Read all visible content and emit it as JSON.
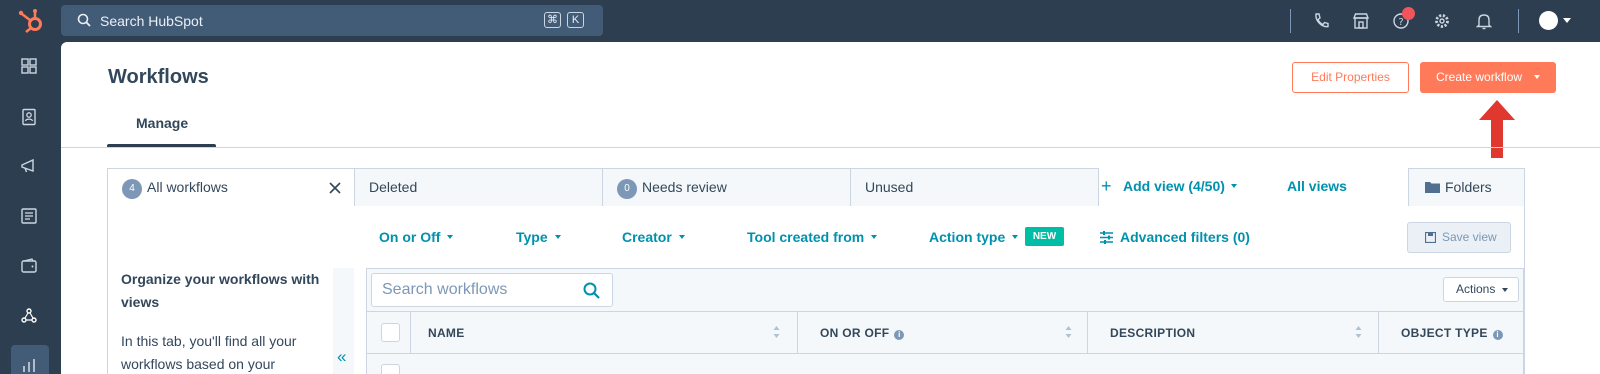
{
  "topbar": {
    "search_placeholder": "Search HubSpot",
    "shortcut_keys": [
      "⌘",
      "K"
    ],
    "icons": [
      "phone-icon",
      "marketplace-icon",
      "help-icon",
      "settings-icon",
      "notifications-icon",
      "avatar"
    ]
  },
  "leftnav": {
    "items": [
      "bookmarks-icon",
      "contacts-icon",
      "marketing-icon",
      "content-icon",
      "commerce-icon",
      "automation-icon",
      "reporting-icon"
    ],
    "active_index": 5
  },
  "header": {
    "title": "Workflows",
    "edit_properties_label": "Edit Properties",
    "create_workflow_label": "Create workflow",
    "tabs": [
      {
        "label": "Manage",
        "active": true
      }
    ]
  },
  "view_tabs": [
    {
      "label": "All workflows",
      "count": "4",
      "active": true
    },
    {
      "label": "Deleted",
      "count": null
    },
    {
      "label": "Needs review",
      "count": "0"
    },
    {
      "label": "Unused",
      "count": null
    }
  ],
  "view_actions": {
    "add_view": "Add view (4/50)",
    "all_views": "All views",
    "folders": "Folders"
  },
  "filters": {
    "items": [
      "On or Off",
      "Type",
      "Creator",
      "Tool created from",
      "Action type"
    ],
    "new_badge": "NEW",
    "advanced": "Advanced filters (0)",
    "save_view": "Save view"
  },
  "sidebar_info": {
    "title": "Organize your workflows with views",
    "text": "In this tab, you'll find all your workflows based on your"
  },
  "table": {
    "search_placeholder": "Search workflows",
    "actions_label": "Actions",
    "columns": [
      "NAME",
      "ON OR OFF",
      "DESCRIPTION",
      "OBJECT TYPE"
    ]
  },
  "colors": {
    "topbar": "#2d3e50",
    "accent": "#ff7a59",
    "link": "#0091ae",
    "new_badge": "#00bda5",
    "annotation_arrow": "#e0372f"
  }
}
